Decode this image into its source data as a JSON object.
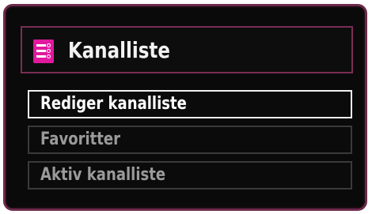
{
  "menu": {
    "title": "Kanalliste",
    "icon": "channel-list-icon",
    "accent_color": "#e0199e",
    "frame_color": "#7a2e55",
    "items": [
      {
        "label": "Rediger kanalliste",
        "selected": true
      },
      {
        "label": "Favoritter",
        "selected": false
      },
      {
        "label": "Aktiv kanalliste",
        "selected": false
      }
    ]
  }
}
